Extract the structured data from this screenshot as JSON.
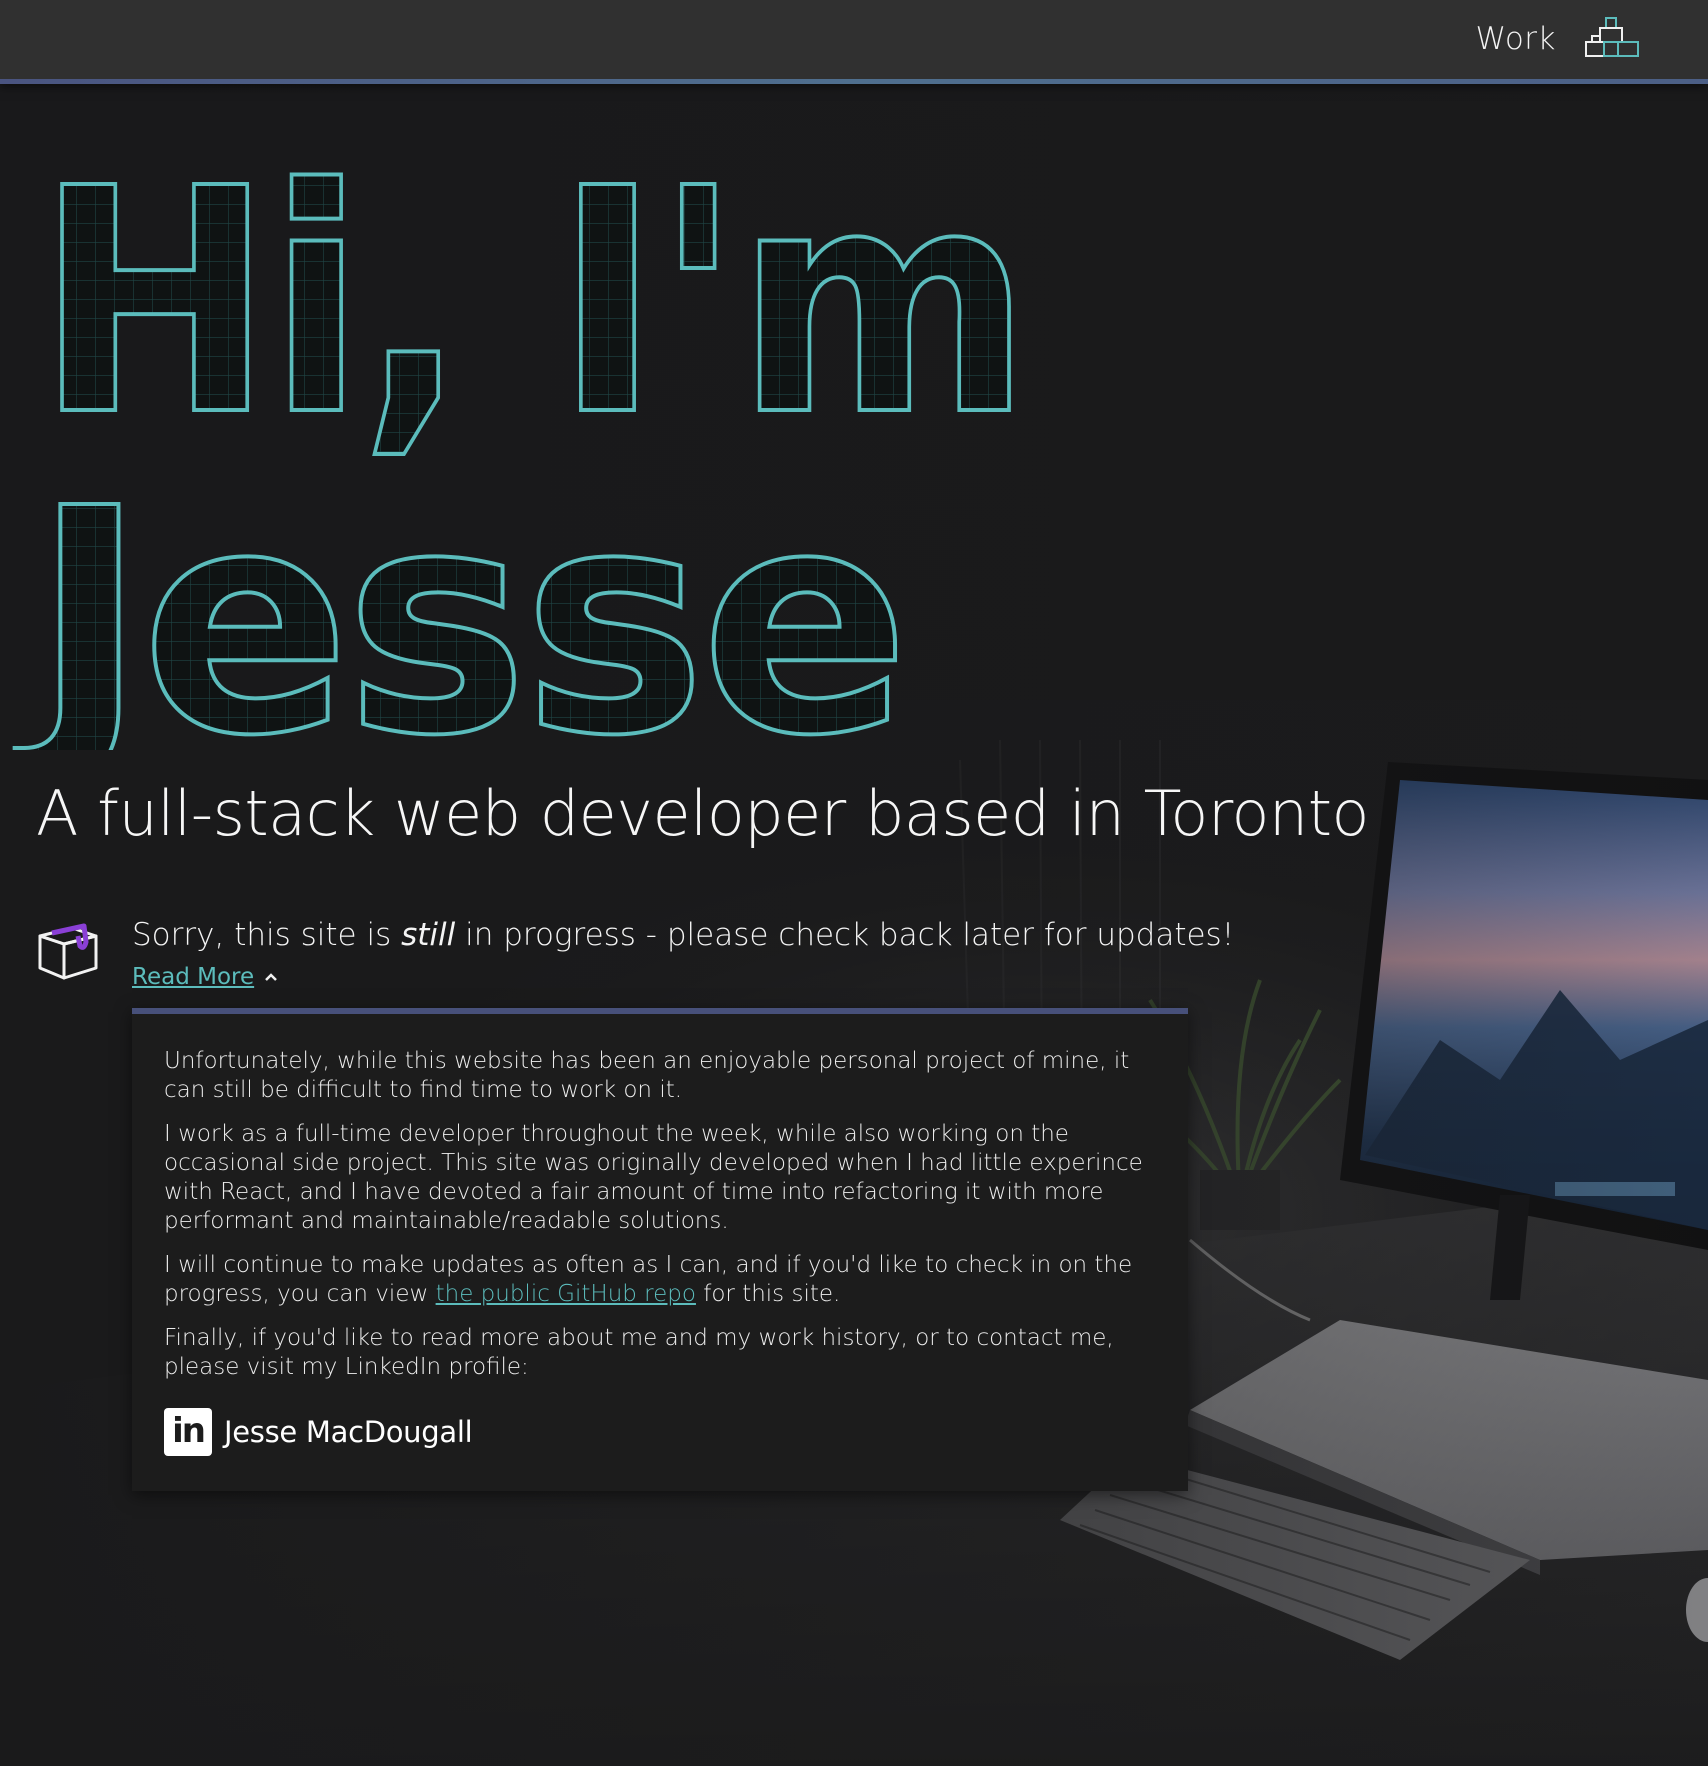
{
  "nav": {
    "work_label": "Work",
    "logo_icon": "stacked-blocks-logo-icon"
  },
  "hero": {
    "line1": "Hi, I'm",
    "line2": "Jesse",
    "outline_color": "#5bbcbc",
    "subtitle": "A full-stack web developer based in Toronto"
  },
  "notice": {
    "icon": "package-box-icon",
    "text_before": "Sorry, this site is ",
    "text_emphasis": "still",
    "text_after": " in progress - please check back later for updates!",
    "read_more": "Read More",
    "read_more_chevron": "chevron-up-icon"
  },
  "panel": {
    "p1": "Unfortunately, while this website has been an enjoyable personal project of mine, it can still be difficult to find time to work on it.",
    "p2": "I work as a full-time developer throughout the week, while also working on the occasional side project. This site was originally developed when I had little experince with React, and I have devoted a fair amount of time into refactoring it with more performant and maintainable/readable solutions.",
    "p3_before": "I will continue to make updates as often as I can, and if you'd like to check in on the progress, you can view ",
    "p3_link": "the public GitHub repo",
    "p3_after": " for this site.",
    "p4": "Finally, if you'd like to read more about me and my work history, or to contact me, please visit my LinkedIn profile:",
    "linkedin_icon_text": "in",
    "linkedin_name": "Jesse MacDougall"
  },
  "colors": {
    "accent_teal": "#5cbcbc",
    "accent_purple": "#8a3fd6",
    "nav_bg": "#303030",
    "panel_bg": "#1c1c1c"
  }
}
